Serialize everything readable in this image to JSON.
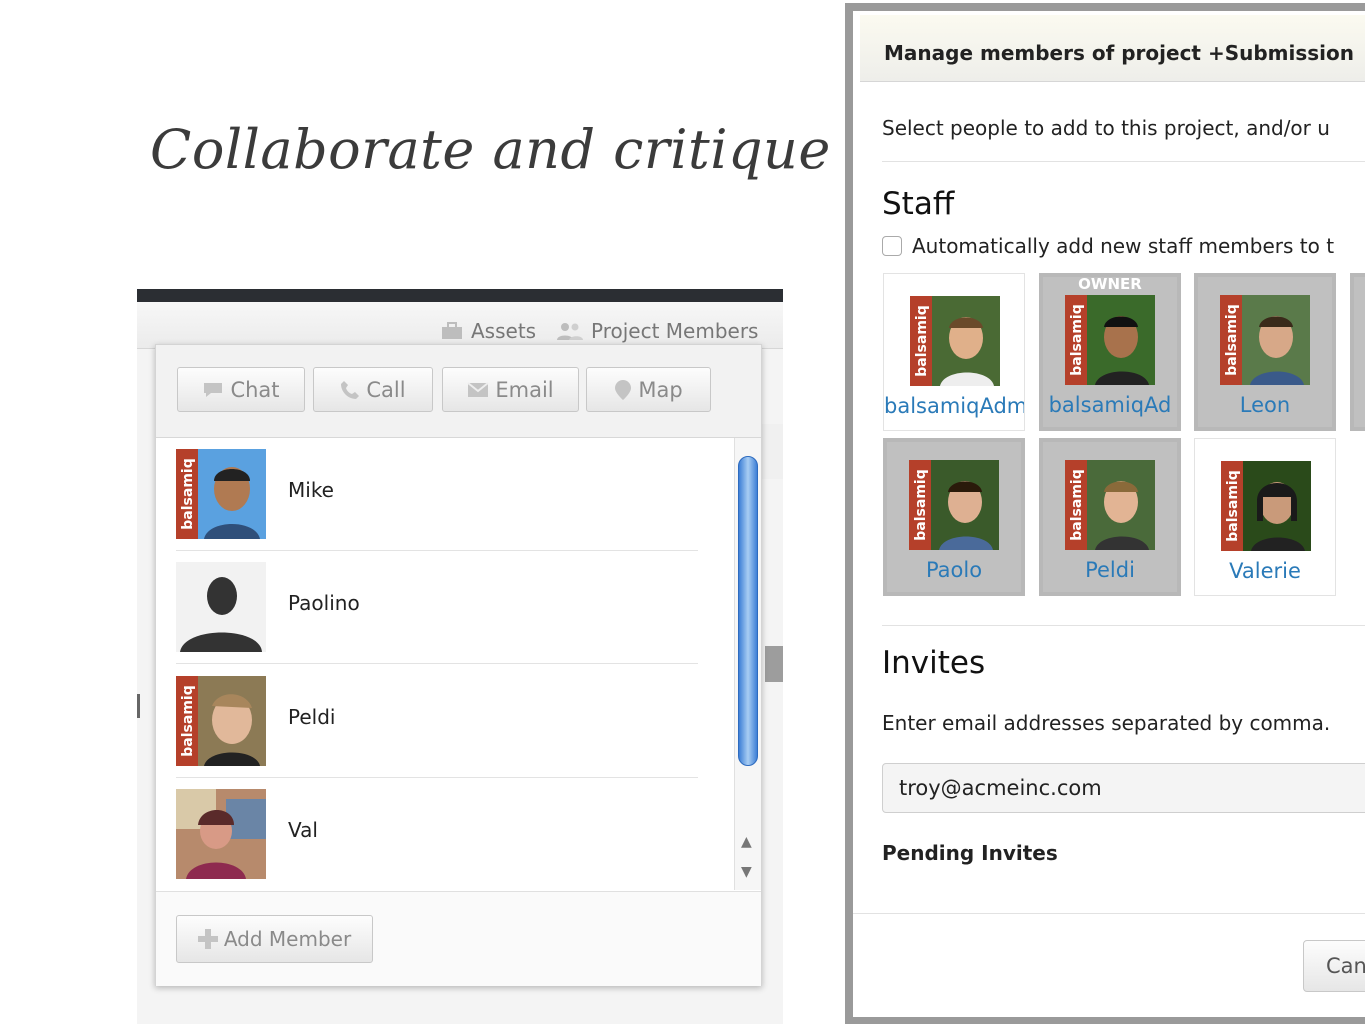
{
  "slide": {
    "title": "Collaborate and critique"
  },
  "left_app": {
    "toolbar": {
      "assets_label": "Assets",
      "members_label": "Project Members"
    },
    "actions": {
      "chat": "Chat",
      "call": "Call",
      "email": "Email",
      "map": "Map"
    },
    "members": [
      {
        "name": "Mike",
        "photo_label": "balsamiq"
      },
      {
        "name": "Paolino"
      },
      {
        "name": "Peldi",
        "photo_label": "balsamiq"
      },
      {
        "name": "Val"
      }
    ],
    "add_member_label": "Add Member"
  },
  "dialog": {
    "title": "Manage members of project +Submission",
    "intro": "Select people to add to this project, and/or u",
    "staff_heading": "Staff",
    "auto_add_label": "Automatically add new staff members to t",
    "staff": [
      {
        "name": "balsamiqAdmin",
        "photo_label": "balsamiq",
        "selected": false
      },
      {
        "name": "balsamiqAd",
        "photo_label": "balsamiq",
        "badge": "OWNER",
        "selected": true
      },
      {
        "name": "Leon",
        "photo_label": "balsamiq",
        "selected": true
      },
      {
        "name": "Paolo",
        "photo_label": "balsamiq",
        "selected": true
      },
      {
        "name": "Peldi",
        "photo_label": "balsamiq",
        "selected": true
      },
      {
        "name": "Valerie",
        "photo_label": "balsamiq",
        "selected": false
      }
    ],
    "invites_heading": "Invites",
    "invites_text": "Enter email addresses separated by comma.",
    "email_value": "troy@acmeinc.com",
    "pending_heading": "Pending Invites",
    "cancel_label": "Can"
  },
  "colors": {
    "link": "#2a7ab8",
    "brand_strip": "#b5402a",
    "scroll_thumb": "#3d7fd6"
  }
}
